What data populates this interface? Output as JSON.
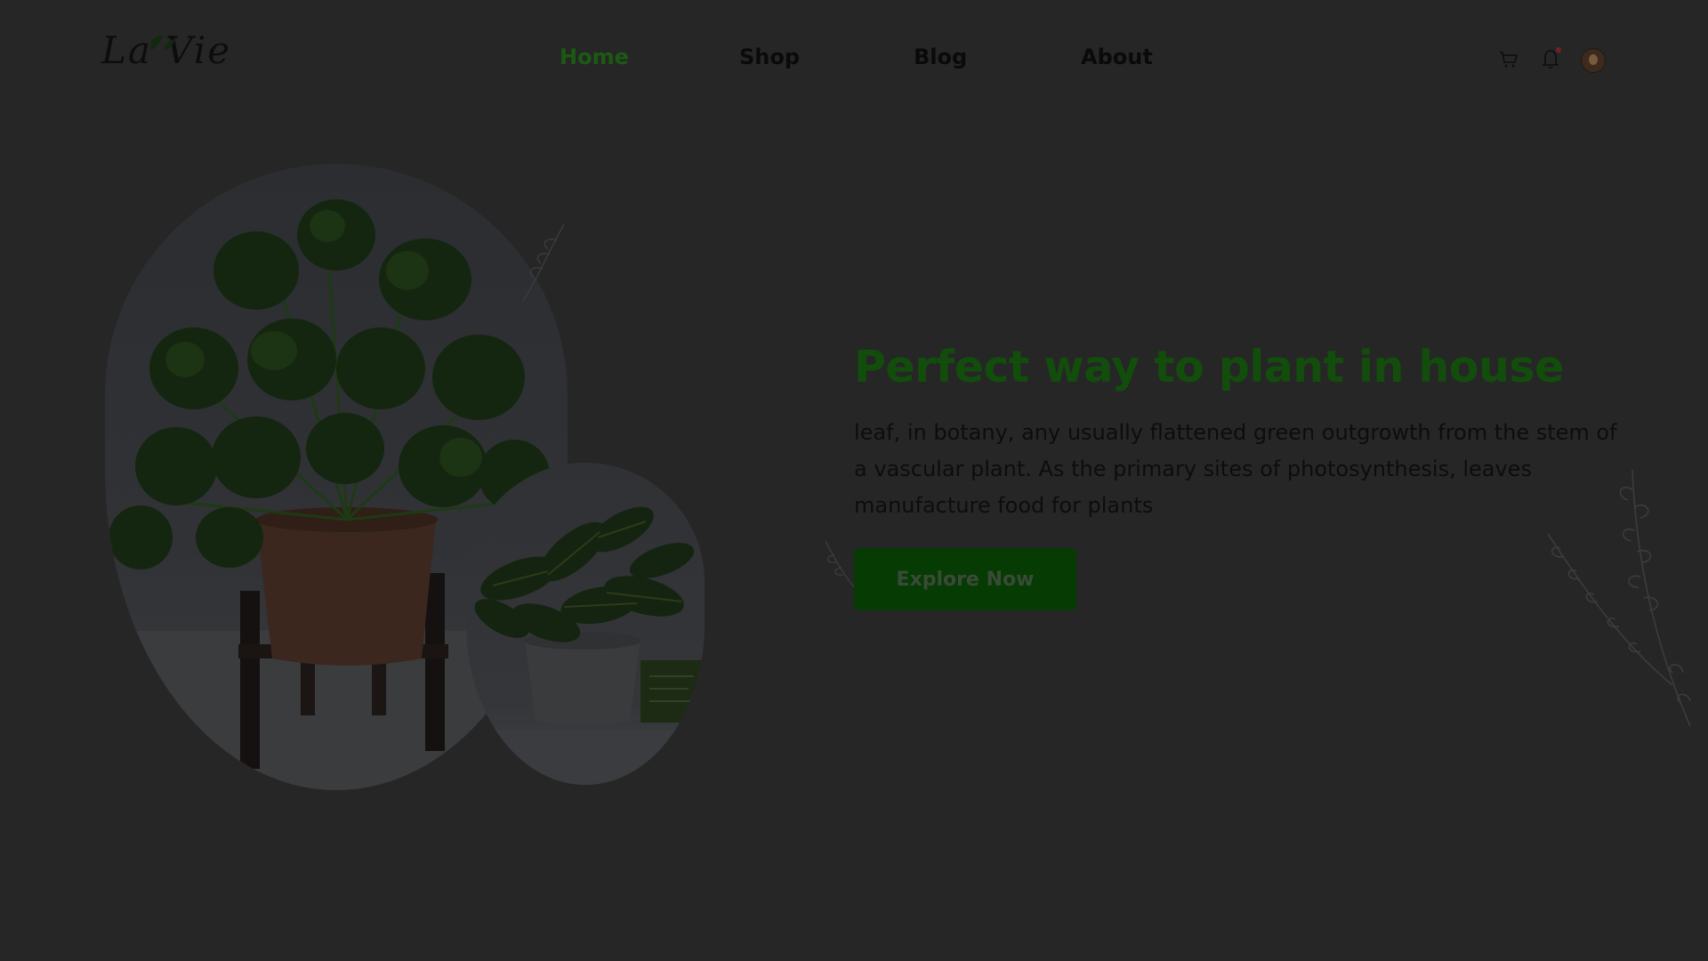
{
  "header": {
    "logo_text": "La Vie",
    "nav": [
      {
        "label": "Home",
        "active": true
      },
      {
        "label": "Shop",
        "active": false
      },
      {
        "label": "Blog",
        "active": false
      },
      {
        "label": "About",
        "active": false
      }
    ],
    "icons": [
      "cart-icon",
      "bell-icon",
      "avatar"
    ]
  },
  "hero": {
    "title": "Perfect way to plant in house",
    "body": "leaf, in botany, any usually flattened green outgrowth from the stem of a vascular plant. As the primary sites of photosynthesis, leaves manufacture food for plants",
    "cta_label": "Explore Now"
  },
  "colors": {
    "background": "#262626",
    "accent": "#124d0c",
    "button": "#063b03",
    "active_nav": "#1c5a14"
  }
}
